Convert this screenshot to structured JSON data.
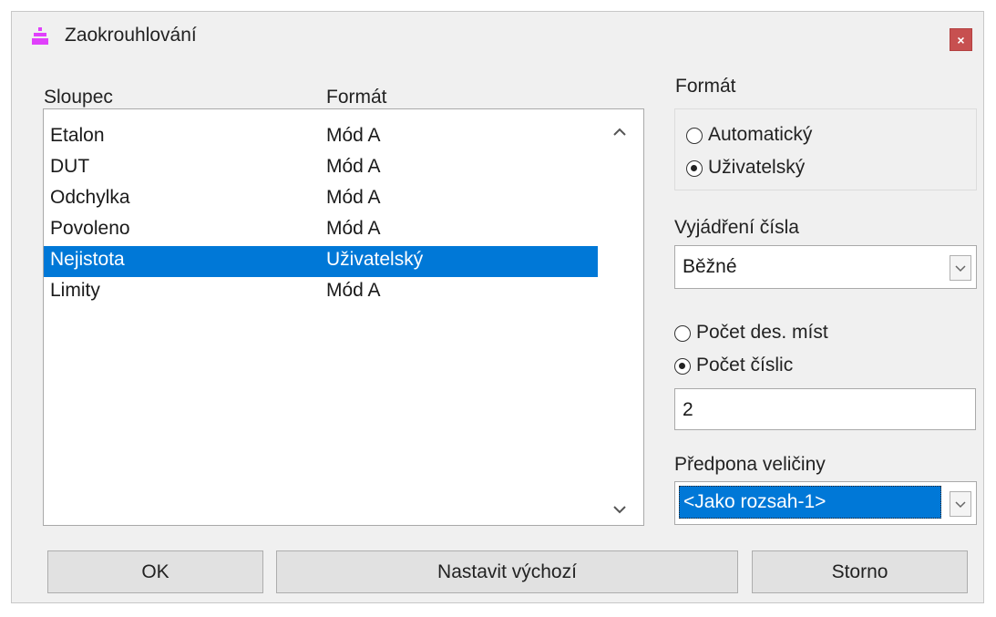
{
  "window": {
    "title": "Zaokrouhlování",
    "close_label": "×",
    "title_icon_color": "#e040fb"
  },
  "list": {
    "headers": [
      "Sloupec",
      "Formát"
    ],
    "rows": [
      {
        "name": "Etalon",
        "format": "Mód A"
      },
      {
        "name": "DUT",
        "format": "Mód A"
      },
      {
        "name": "Odchylka",
        "format": "Mód A"
      },
      {
        "name": "Povoleno",
        "format": "Mód A"
      },
      {
        "name": "Nejistota",
        "format": "Uživatelský"
      },
      {
        "name": "Limity",
        "format": "Mód A"
      }
    ],
    "selected_row": "Nejistota",
    "scroll_up_icon": "chevron-up-icon",
    "scroll_down_icon": "chevron-down-icon"
  },
  "format_group": {
    "label": "Formát",
    "options": [
      {
        "label": "Automatický",
        "checked": false
      },
      {
        "label": "Uživatelský",
        "checked": true
      }
    ]
  },
  "number_expression": {
    "label": "Vyjádření čísla",
    "value": "Běžné"
  },
  "precision": {
    "options": [
      {
        "label": "Počet des. míst",
        "checked": false
      },
      {
        "label": "Počet číslic",
        "checked": true
      }
    ],
    "value": "2"
  },
  "prefix": {
    "label": "Předpona veličiny",
    "value": "<Jako rozsah-1>"
  },
  "buttons": {
    "ok": "OK",
    "defaults": "Nastavit výchozí",
    "cancel": "Storno"
  },
  "colors": {
    "selection": "#0078d7",
    "close": "#c75050"
  }
}
